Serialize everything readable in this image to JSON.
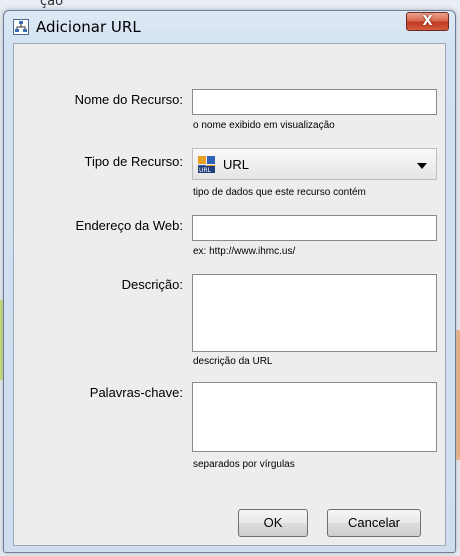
{
  "desktop": {
    "title_fragment": "ção"
  },
  "window": {
    "title": "Adicionar URL",
    "close_label": "X",
    "icon": "network-resource-icon"
  },
  "form": {
    "name": {
      "label": "Nome do Recurso:",
      "value": "",
      "hint": "o nome exibido em visualização"
    },
    "type": {
      "label": "Tipo de Recurso:",
      "selected": "URL",
      "icon": "url-resource-icon",
      "hint": "tipo de dados que este recurso contém"
    },
    "address": {
      "label": "Endereço da Web:",
      "value": "",
      "hint": "ex: http://www.ihmc.us/"
    },
    "description": {
      "label": "Descrição:",
      "value": "",
      "hint": "descrição da URL"
    },
    "keywords": {
      "label": "Palavras-chave:",
      "value": "",
      "hint": "separados por vírgulas"
    }
  },
  "buttons": {
    "ok": "OK",
    "cancel": "Cancelar"
  },
  "colors": {
    "close_button": "#c23a22",
    "frame": "#d3e1f1",
    "panel": "#ededed"
  }
}
